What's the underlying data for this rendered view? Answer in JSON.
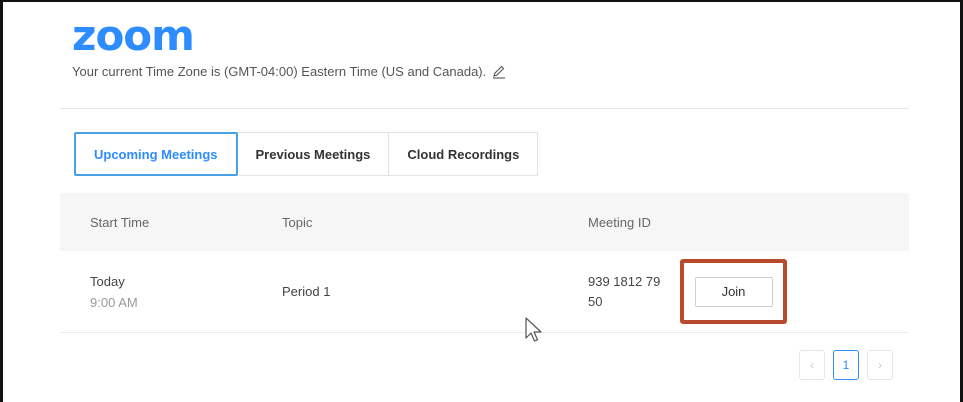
{
  "brand": {
    "logo_text": "zoom",
    "accent": "#2d8cff"
  },
  "timezone": {
    "text": "Your current Time Zone is (GMT-04:00) Eastern Time (US and Canada).",
    "edit_icon": "pencil-icon"
  },
  "tabs": [
    {
      "label": "Upcoming Meetings",
      "active": true
    },
    {
      "label": "Previous Meetings",
      "active": false
    },
    {
      "label": "Cloud Recordings",
      "active": false
    }
  ],
  "table": {
    "headers": {
      "start_time": "Start Time",
      "topic": "Topic",
      "meeting_id": "Meeting ID"
    },
    "rows": [
      {
        "day": "Today",
        "time": "9:00 AM",
        "topic": "Period 1",
        "meeting_id_line1": "939 1812 79",
        "meeting_id_line2": "50",
        "action": "Join"
      }
    ]
  },
  "pagination": {
    "prev": "‹",
    "current": "1",
    "next": "›"
  },
  "highlight_color": "#b84a2e"
}
